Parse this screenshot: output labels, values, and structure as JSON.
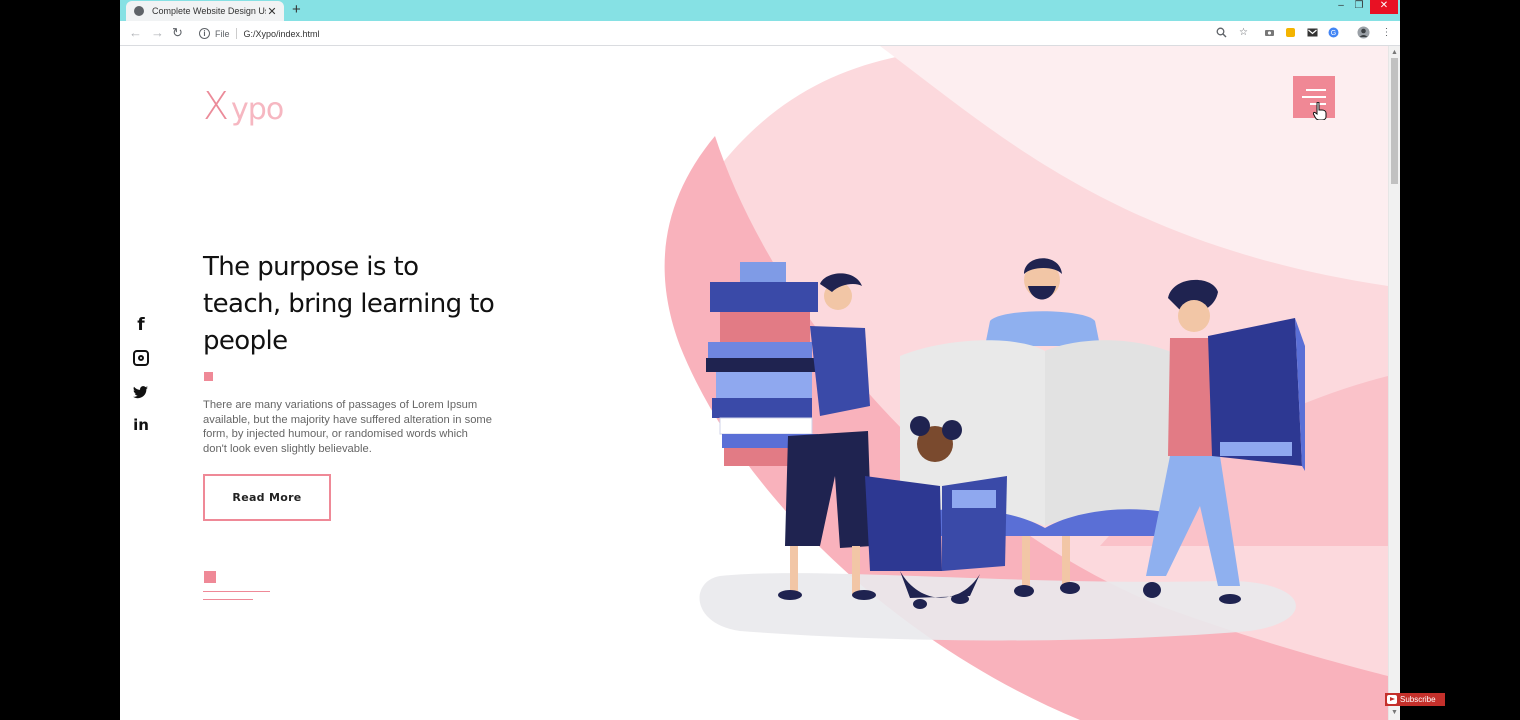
{
  "browser": {
    "tab_title": "Complete Website Design Using",
    "new_tab_symbol": "+",
    "close_tab_symbol": "✕",
    "url_scheme_label": "File",
    "url": "G:/Xypo/index.html",
    "window_controls": {
      "minimize": "–",
      "maximize": "❐",
      "close": "✕"
    },
    "toolbar_icons": [
      "zoom-icon",
      "star-icon",
      "camera-extension-icon",
      "bell-extension-icon",
      "gmail-extension-icon",
      "google-extension-icon",
      "profile-avatar",
      "menu-dots-icon"
    ]
  },
  "site": {
    "logo_x": "X",
    "logo_rest": "ypo",
    "hero_title": "The purpose is to teach, bring learning to people",
    "hero_description": "There are many variations of passages of Lorem Ipsum available, but the majority have suffered alteration in some form, by injected humour, or randomised words which don't look even slightly believable.",
    "read_more_label": "Read More",
    "social": {
      "facebook": "f",
      "linkedin": "in"
    },
    "accent_color": "#ef8997"
  },
  "overlay": {
    "subscribe_label": "Subscribe"
  }
}
